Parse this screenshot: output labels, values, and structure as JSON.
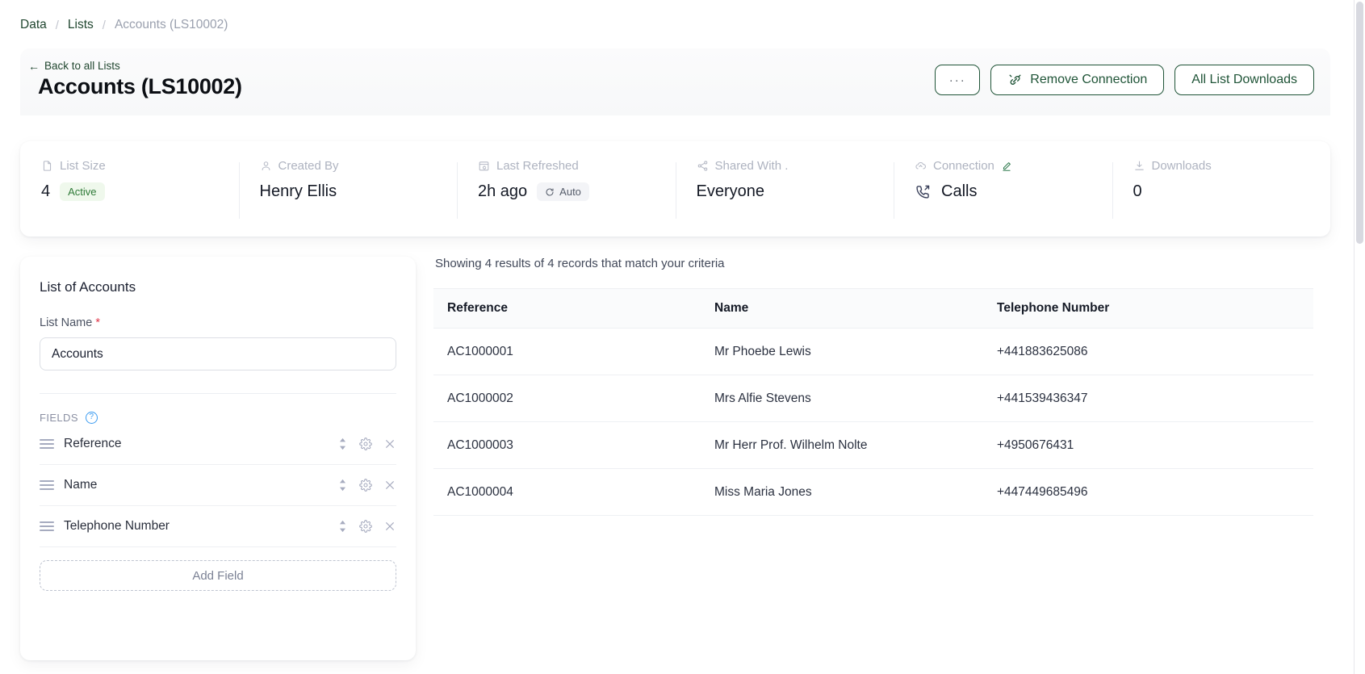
{
  "breadcrumb": {
    "items": [
      "Data",
      "Lists",
      "Accounts (LS10002)"
    ]
  },
  "header": {
    "back_label": "Back to all Lists",
    "back_arrow": "←",
    "title": "Accounts (LS10002)",
    "more_label": "···",
    "remove_connection_label": "Remove Connection",
    "all_downloads_label": "All List Downloads",
    "accent_color": "#1f5437"
  },
  "stats": [
    {
      "label": "List Size",
      "icon": "document-icon",
      "value": "4",
      "badge": "Active",
      "badge_type": "active"
    },
    {
      "label": "Created By",
      "icon": "user-icon",
      "value": "Henry Ellis",
      "badge": null,
      "badge_type": null
    },
    {
      "label": "Last Refreshed",
      "icon": "calendar-refresh-icon",
      "value": "2h ago",
      "badge": "Auto",
      "badge_type": "auto"
    },
    {
      "label": "Shared With .",
      "icon": "share-icon",
      "value": "Everyone",
      "badge": null,
      "badge_type": null
    },
    {
      "label": "Connection",
      "icon": "cloud-icon",
      "edit_icon": "pencil-icon",
      "value": "Calls",
      "value_icon": "outgoing-call-icon",
      "badge": null,
      "badge_type": null
    },
    {
      "label": "Downloads",
      "icon": "download-icon",
      "value": "0",
      "badge": null,
      "badge_type": null
    }
  ],
  "left_panel": {
    "title": "List of Accounts",
    "list_name_label": "List Name",
    "required_marker": "*",
    "list_name_value": "Accounts",
    "list_name_placeholder": "Enter list name",
    "fields_label": "FIELDS",
    "help_glyph": "?",
    "fields": [
      {
        "name": "Reference"
      },
      {
        "name": "Name"
      },
      {
        "name": "Telephone Number"
      }
    ],
    "add_field_label": "Add Field"
  },
  "results": {
    "note": "Showing 4 results of 4 records that match your criteria",
    "columns": [
      "Reference",
      "Name",
      "Telephone Number"
    ],
    "rows": [
      {
        "reference": "AC1000001",
        "name": "Mr Phoebe Lewis",
        "telephone": "+441883625086"
      },
      {
        "reference": "AC1000002",
        "name": "Mrs Alfie Stevens",
        "telephone": "+441539436347"
      },
      {
        "reference": "AC1000003",
        "name": "Mr Herr Prof. Wilhelm Nolte",
        "telephone": "+4950676431"
      },
      {
        "reference": "AC1000004",
        "name": "Miss Maria Jones",
        "telephone": "+447449685496"
      }
    ]
  }
}
